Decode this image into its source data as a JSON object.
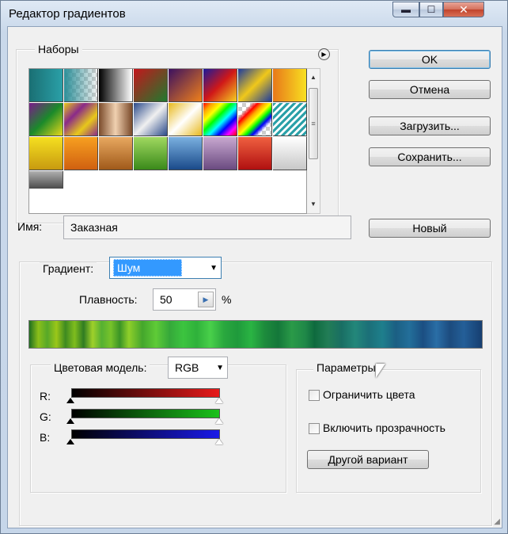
{
  "window": {
    "title": "Редактор градиентов",
    "minimize_glyph": "▬",
    "maximize_glyph": "☐",
    "close_glyph": "✕"
  },
  "presets": {
    "label": "Наборы",
    "menu_icon": "circle-arrow-right-icon"
  },
  "buttons": {
    "ok": "OK",
    "cancel": "Отмена",
    "load": "Загрузить...",
    "save": "Сохранить...",
    "new": "Новый"
  },
  "name": {
    "label": "Имя:",
    "value": "Заказная"
  },
  "gradient": {
    "type_label": "Градиент:",
    "type_value": "Шум",
    "smoothness_label": "Плавность:",
    "smoothness_value": "50",
    "smoothness_unit": "%"
  },
  "color_model": {
    "label": "Цветовая модель:",
    "value": "RGB",
    "channels": [
      "R:",
      "G:",
      "B:"
    ],
    "colors": {
      "R": "#e81a1a",
      "G": "#1ac21a",
      "B": "#1a1ae8"
    }
  },
  "options": {
    "label": "Параметры:",
    "restrict_colors": "Ограничить цвета",
    "add_transparency": "Включить прозрачность",
    "randomize": "Другой вариант"
  }
}
